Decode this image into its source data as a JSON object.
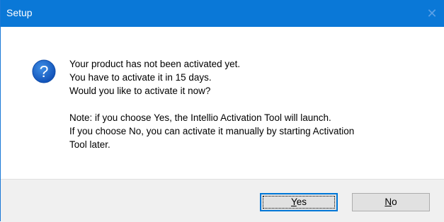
{
  "window": {
    "title": "Setup",
    "close_glyph": "✕",
    "accent_color": "#0a78d7"
  },
  "icon": {
    "name": "question-icon",
    "glyph": "?",
    "color": "#1c66c9"
  },
  "message": {
    "line1": "Your product has not been activated yet.",
    "line2": "You have to activate it in 15 days.",
    "line3": "Would you like to activate it now?",
    "line4": "Note: if you choose Yes, the Intellio Activation Tool will launch.",
    "line5": "If you choose No, you can activate it manually by starting Activation",
    "line6": "Tool later."
  },
  "buttons": {
    "yes": {
      "mnemonic": "Y",
      "rest": "es"
    },
    "no": {
      "mnemonic": "N",
      "rest": "o"
    }
  }
}
